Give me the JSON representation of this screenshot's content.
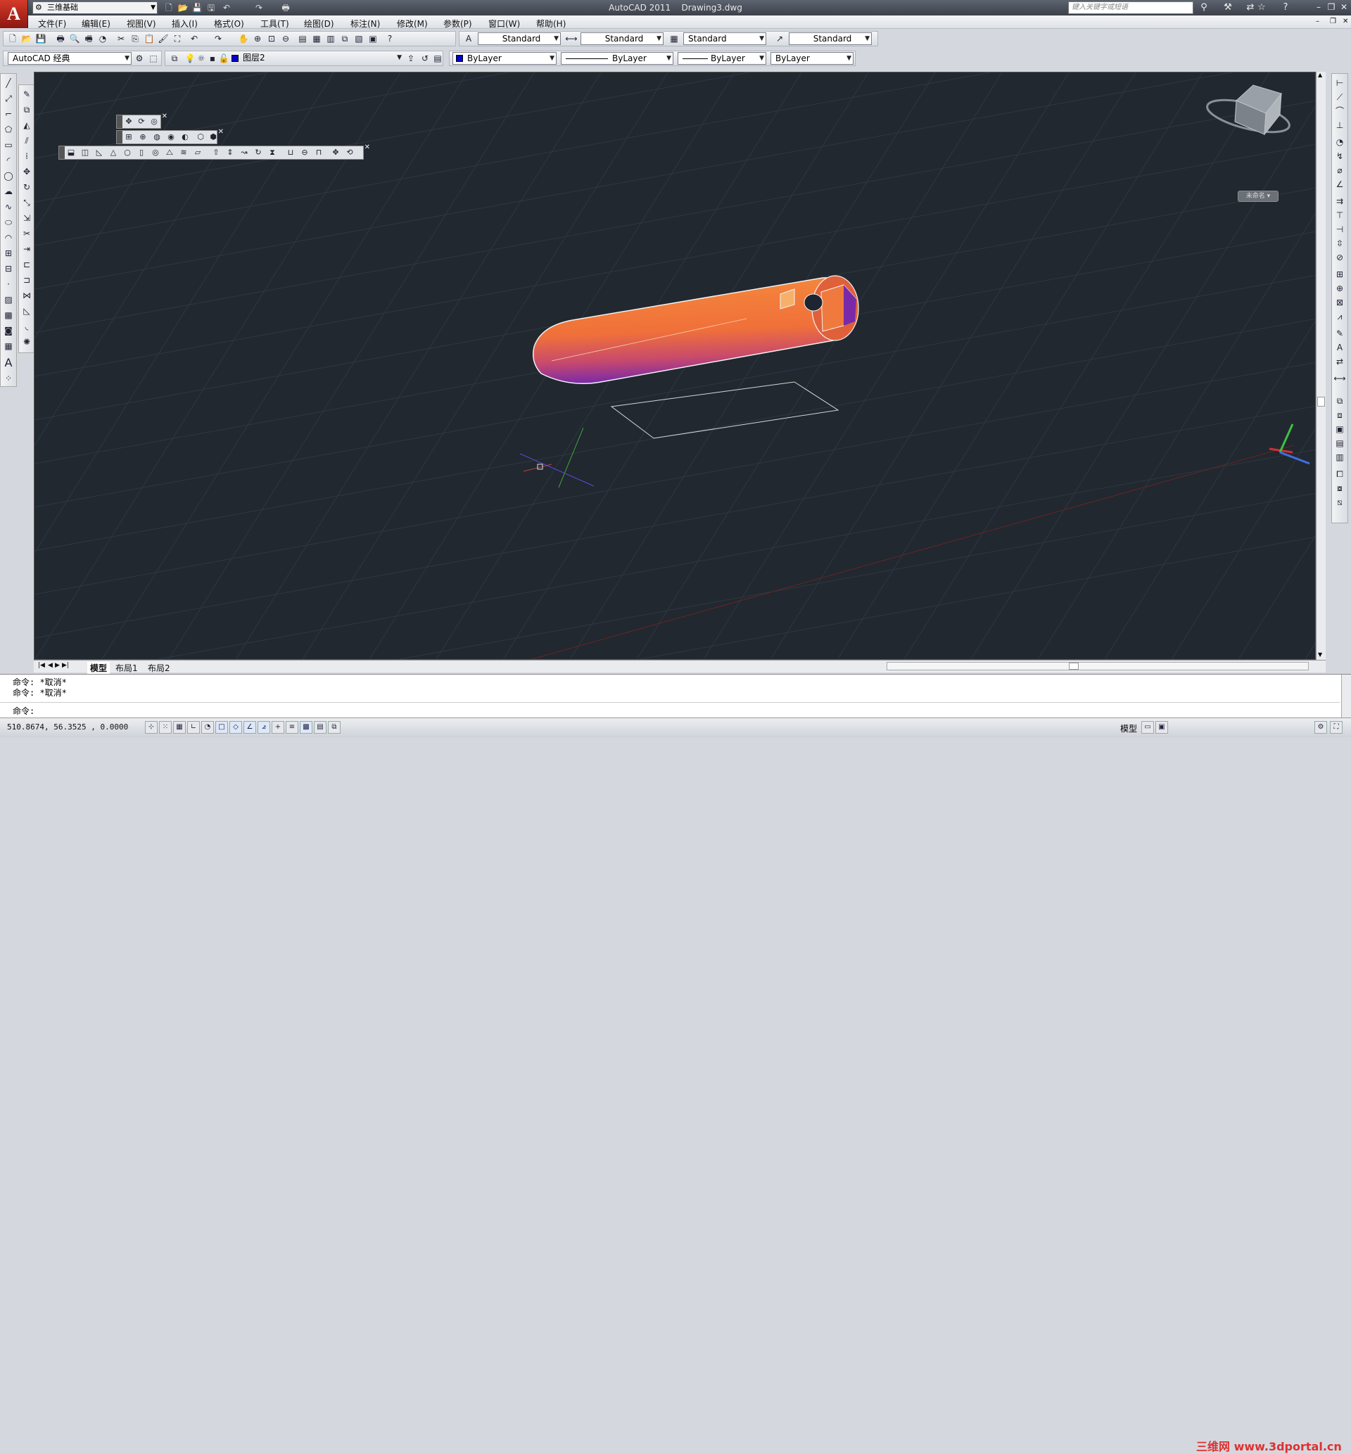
{
  "window": {
    "app": "AutoCAD 2011",
    "file": "Drawing3.dwg"
  },
  "app_button": {
    "letter": "A"
  },
  "quick_access": {
    "workspace": "三维基础"
  },
  "search": {
    "placeholder": "键入关键字或短语"
  },
  "menu": [
    "文件(F)",
    "编辑(E)",
    "视图(V)",
    "插入(I)",
    "格式(O)",
    "工具(T)",
    "绘图(D)",
    "标注(N)",
    "修改(M)",
    "参数(P)",
    "窗口(W)",
    "帮助(H)"
  ],
  "styles": {
    "text_style": "Standard",
    "dim_style": "Standard",
    "table_style": "Standard",
    "mleader_style": "Standard"
  },
  "workspace_combo": "AutoCAD 经典",
  "layer": {
    "current": "图层2",
    "color_swatch": "#0000cc"
  },
  "properties": {
    "color": "ByLayer",
    "linetype": "ByLayer",
    "lineweight": "ByLayer",
    "plotstyle": "ByLayer"
  },
  "viewcube": {
    "label": "未命名"
  },
  "tabs": [
    "模型",
    "布局1",
    "布局2"
  ],
  "command_history": [
    "命令: *取消*",
    "命令: *取消*"
  ],
  "command_prompt": "命令:",
  "coordinates": "510.8674,  56.3525 , 0.0000",
  "status_right": {
    "model": "模型"
  },
  "watermark": "三维网 www.3dportal.cn",
  "colors": {
    "canvas": "#212830",
    "solid_top": "#f07a3e",
    "solid_bottom": "#8a2fb0",
    "grid": "#2e3742"
  }
}
